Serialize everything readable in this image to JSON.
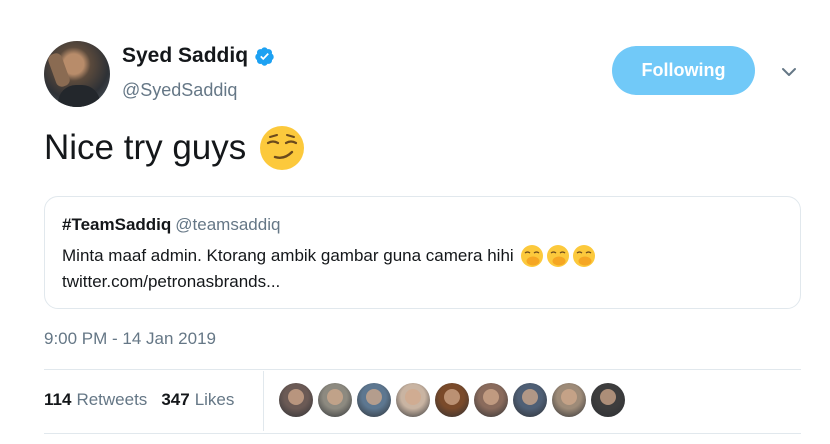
{
  "author": {
    "name": "Syed Saddiq",
    "handle": "@SyedSaddiq",
    "verified": true
  },
  "follow_button": {
    "label": "Following",
    "color": "#71c9f8"
  },
  "tweet": {
    "text": "Nice try guys",
    "emoji": "smirking-face"
  },
  "quote": {
    "name": "#TeamSaddiq",
    "handle": "@teamsaddiq",
    "text": "Minta maaf admin. Ktorang ambik gambar guna camera hihi",
    "emojis": [
      "face-with-hand-over-mouth",
      "face-with-hand-over-mouth",
      "face-with-hand-over-mouth"
    ],
    "link": "twitter.com/petronasbrands..."
  },
  "timestamp": "9:00 PM - 14 Jan 2019",
  "stats": {
    "retweets_count": "114",
    "retweets_label": "Retweets",
    "likes_count": "347",
    "likes_label": "Likes"
  },
  "likers": [
    {
      "color": "#6b5a55"
    },
    {
      "color": "#8d8a80"
    },
    {
      "color": "#5d7790"
    },
    {
      "color": "#c9b4a2"
    },
    {
      "color": "#7a4a2a"
    },
    {
      "color": "#8a6b5c"
    },
    {
      "color": "#4f5f75"
    },
    {
      "color": "#9e8b78"
    },
    {
      "color": "#3d3d3d"
    }
  ],
  "colors": {
    "text_primary": "#14171a",
    "text_secondary": "#657786",
    "border": "#e1e8ed",
    "verified_blue": "#1da1f2"
  }
}
